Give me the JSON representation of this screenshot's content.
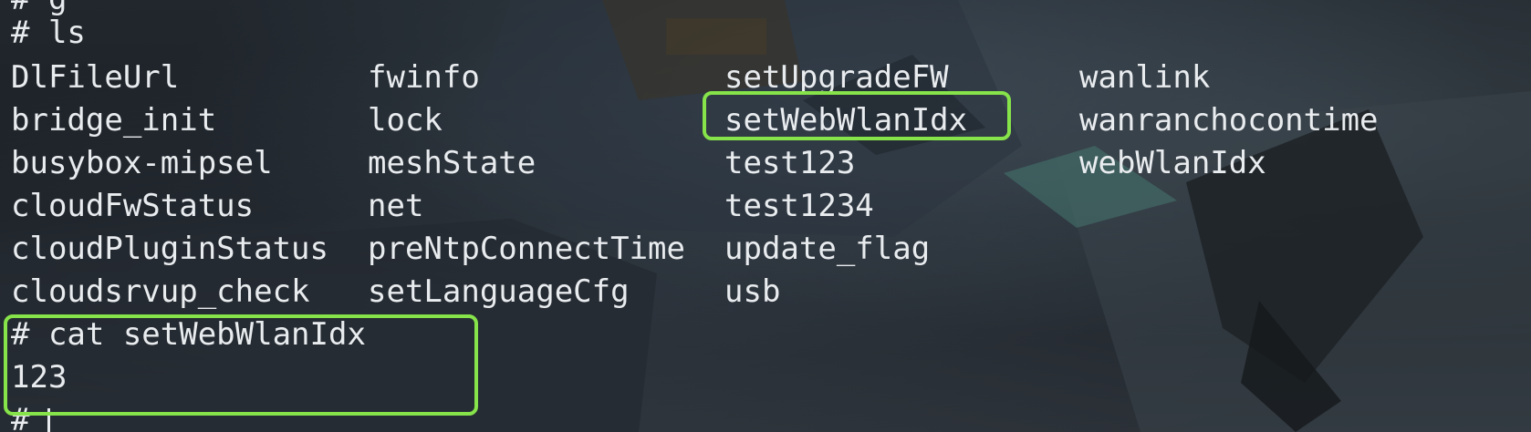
{
  "terminal": {
    "partial_top_line": "# g",
    "ls_command": "# ls",
    "ls_columns": [
      [
        "DlFileUrl",
        "bridge_init",
        "busybox-mipsel",
        "cloudFwStatus",
        "cloudPluginStatus",
        "cloudsrvup_check"
      ],
      [
        "fwinfo",
        "lock",
        "meshState",
        "net",
        "preNtpConnectTime",
        "setLanguageCfg"
      ],
      [
        "setUpgradeFW",
        "setWebWlanIdx",
        "test123",
        "test1234",
        "update_flag",
        "usb"
      ],
      [
        "wanlink",
        "wanranchocontime",
        "webWlanIdx"
      ]
    ],
    "cat_command": "# cat setWebWlanIdx",
    "cat_output": "123",
    "prompt_partial": "#"
  },
  "colors": {
    "text": "#e9ecef",
    "highlight_box": "#86e34a"
  }
}
